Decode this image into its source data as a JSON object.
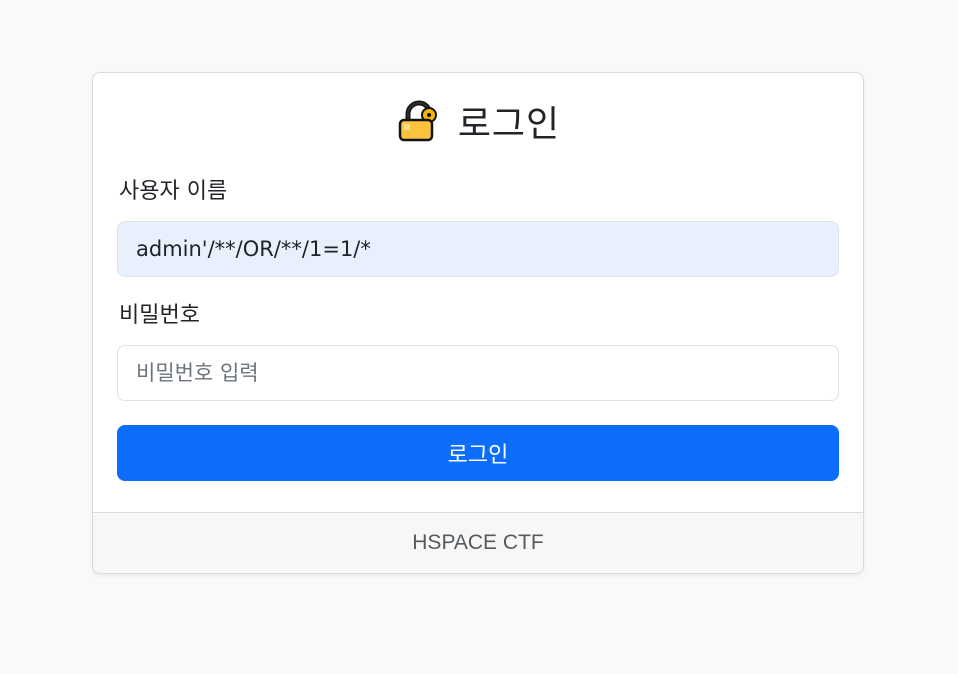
{
  "login": {
    "title": "로그인",
    "icon": "lock-icon",
    "username_label": "사용자 이름",
    "username_value": "admin'/**/OR/**/1=1/*",
    "password_label": "비밀번호",
    "password_placeholder": "비밀번호 입력",
    "submit_label": "로그인"
  },
  "footer": {
    "text": "HSPACE CTF"
  },
  "colors": {
    "accent": "#0d6efd",
    "autofill_bg": "#e8f0fe",
    "page_bg": "#f8f9fa"
  }
}
